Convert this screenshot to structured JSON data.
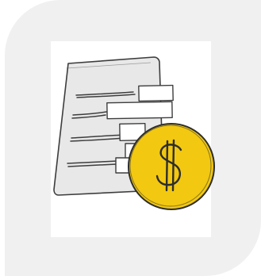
{
  "illustration": {
    "document_icon": "invoice-document-icon",
    "coin_icon": "dollar-coin-icon",
    "colors": {
      "card_background": "#f0f0f0",
      "tile_background": "#ffffff",
      "page_fill": "#e8e8e8",
      "sketch_stroke": "#3d3d3d",
      "coin_fill": "#f2c811",
      "coin_stroke": "#2d2d2d"
    }
  }
}
